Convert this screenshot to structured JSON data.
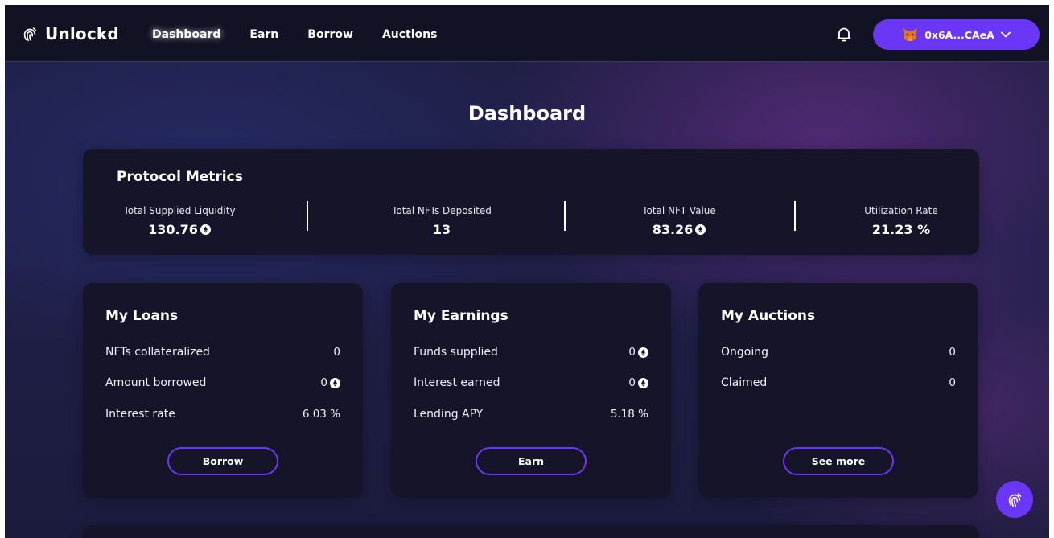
{
  "app": {
    "name": "Unlockd"
  },
  "nav": {
    "items": [
      {
        "label": "Dashboard",
        "active": true
      },
      {
        "label": "Earn"
      },
      {
        "label": "Borrow"
      },
      {
        "label": "Auctions"
      }
    ]
  },
  "wallet": {
    "address": "0x6A...CAeA"
  },
  "page": {
    "title": "Dashboard"
  },
  "metrics": {
    "title": "Protocol Metrics",
    "items": [
      {
        "label": "Total Supplied Liquidity",
        "value": "130.76",
        "eth": true
      },
      {
        "label": "Total NFTs Deposited",
        "value": "13",
        "eth": false
      },
      {
        "label": "Total NFT Value",
        "value": "83.26",
        "eth": true
      },
      {
        "label": "Utilization Rate",
        "value": "21.23 %",
        "eth": false
      }
    ]
  },
  "loans": {
    "title": "My Loans",
    "rows": [
      {
        "label": "NFTs collateralized",
        "value": "0"
      },
      {
        "label": "Amount borrowed",
        "value": "0"
      },
      {
        "label": "Interest rate",
        "value": "6.03 %"
      }
    ],
    "button": "Borrow"
  },
  "earnings": {
    "title": "My Earnings",
    "rows": [
      {
        "label": "Funds supplied",
        "value": "0"
      },
      {
        "label": "Interest earned",
        "value": "0"
      },
      {
        "label": "Lending APY",
        "value": "5.18 %"
      }
    ],
    "button": "Earn"
  },
  "auctions": {
    "title": "My Auctions",
    "rows": [
      {
        "label": "Ongoing",
        "value": "0"
      },
      {
        "label": "Claimed",
        "value": "0"
      }
    ],
    "button": "See more"
  },
  "icons": {
    "logo": "fingerprint-icon",
    "bell": "bell-icon",
    "wallet": "metamask-fox-icon",
    "chevron": "chevron-down-icon",
    "eth": "eth-icon",
    "fab": "fingerprint-icon"
  },
  "colors": {
    "accent": "#6b37f6",
    "card": "#151429",
    "topbar": "#121225"
  }
}
